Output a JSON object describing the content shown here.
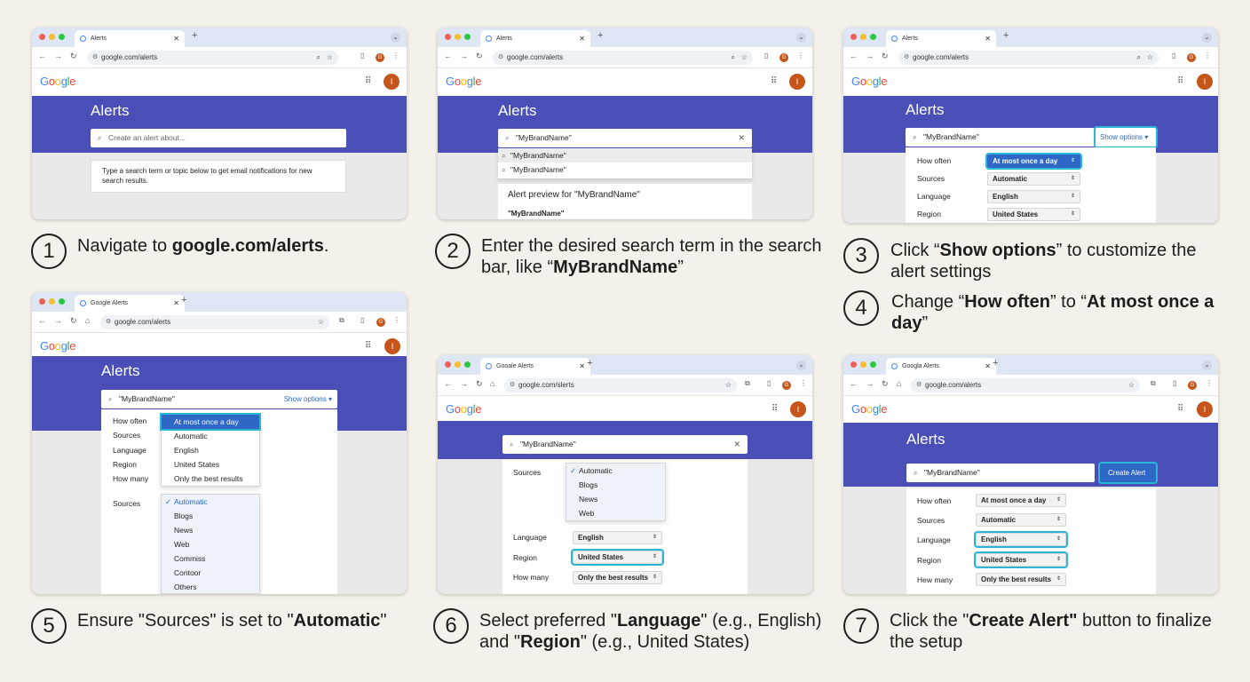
{
  "colors": {
    "page_bg": "#f4f1ea",
    "header_blue": "#4a4fb8",
    "highlight": "#2bb6d8",
    "selected": "#2e67c6",
    "avatar": "#c5551a"
  },
  "browser": {
    "tab_alerts": "Alerts",
    "tab_google_alerts": "Google Alerts",
    "tab_google_alerts_typo": "Gooale Alerts",
    "tab_google_alerts_typo2": "Googla Alerts",
    "url": "google.com/alerts",
    "url_typo": "google.com/slerts",
    "avatar_initial": "G",
    "google_logo": "Google",
    "account_initial": "I"
  },
  "panel1": {
    "title": "Alerts",
    "search_placeholder": "Create an alert about...",
    "hint": "Type a search term or topic below to get email notifications for new search results."
  },
  "panel2": {
    "title": "Alerts",
    "search_value": "\"MyBrandName\"",
    "suggestions": [
      "\"MyBrandName\"",
      "\"MyBrandName\""
    ],
    "preview_title": "Alert preview for \"MyBrandName\"",
    "preview_item": "\"MyBrandName\""
  },
  "panel3": {
    "title": "Alerts",
    "search_value": "\"MyBrandName\"",
    "show_options": "Show options ▾",
    "labels": [
      "How often",
      "Sources",
      "Language",
      "Region"
    ],
    "values": [
      "At most once a day",
      "Automatic",
      "English",
      "United States"
    ]
  },
  "panel5": {
    "title": "Alerts",
    "search_value": "\"MyBrandName\"",
    "show_options": "Show options ▾",
    "labels": [
      "How often",
      "Sources",
      "Language",
      "Region",
      "How many"
    ],
    "often_options": [
      "At most once a day",
      "Automatic",
      "English",
      "United States",
      "Only the best results"
    ],
    "sources_label": "Sources",
    "sources_options": [
      "Automatic",
      "Blogs",
      "News",
      "Web",
      "Commiss",
      "Contoor",
      "Others"
    ]
  },
  "panel6": {
    "search_value": "\"MyBrandName\"",
    "sources_label": "Sources",
    "sources_options": [
      "Automatic",
      "Blogs",
      "News",
      "Web"
    ],
    "labels": [
      "Language",
      "Region",
      "How many"
    ],
    "values": [
      "English",
      "United States",
      "Only the best results"
    ]
  },
  "panel7": {
    "title": "Alerts",
    "search_value": "\"MyBrandName\"",
    "create_button": "Create Alert",
    "labels": [
      "How often",
      "Sources",
      "Language",
      "Region",
      "Hew many"
    ],
    "values": [
      "At most once a day",
      "Automatic",
      "English",
      "United States",
      "Only the best results"
    ]
  },
  "steps": [
    {
      "n": "1",
      "pre": "Navigate to ",
      "b": "google.com/alerts",
      "post": "."
    },
    {
      "n": "2",
      "pre": "Enter the desired search term in the search bar, like “",
      "b": "MyBrandName",
      "post": "”"
    },
    {
      "n": "3",
      "pre": "Click “",
      "b": "Show options",
      "post": "” to customize the alert settings"
    },
    {
      "n": "4",
      "pre": "Change “",
      "b": "How often",
      "mid": "” to “",
      "b2": "At most once a day",
      "post": "”"
    },
    {
      "n": "5",
      "pre": "Ensure \"Sources\" is set to \"",
      "b": "Automatic",
      "post": "\""
    },
    {
      "n": "6",
      "pre": "Select preferred \"",
      "b": "Language",
      "mid": "\" (e.g., English) and \"",
      "b2": "Region",
      "post": "\" (e.g., United States)"
    },
    {
      "n": "7",
      "pre": "Click the \"",
      "b": "Create Alert\"",
      "post": " button to finalize the setup"
    }
  ]
}
